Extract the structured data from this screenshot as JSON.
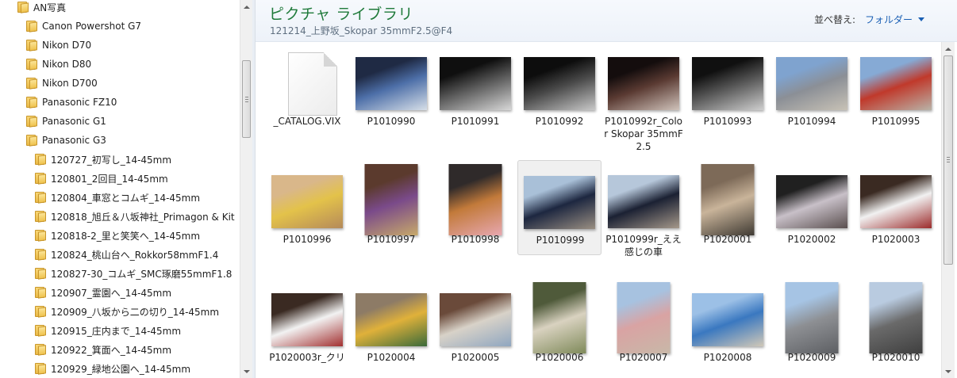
{
  "nav": {
    "items": [
      {
        "label": "AN写真",
        "level": 0
      },
      {
        "label": "Canon Powershot G7",
        "level": 1
      },
      {
        "label": "Nikon D70",
        "level": 1
      },
      {
        "label": "Nikon D80",
        "level": 1
      },
      {
        "label": "Nikon D700",
        "level": 1
      },
      {
        "label": "Panasonic FZ10",
        "level": 1
      },
      {
        "label": "Panasonic G1",
        "level": 1
      },
      {
        "label": "Panasonic G3",
        "level": 1
      },
      {
        "label": "120727_初写し_14-45mm",
        "level": 2
      },
      {
        "label": "120801_2回目_14-45mm",
        "level": 2
      },
      {
        "label": "120804_車窓とコムギ_14-45mm",
        "level": 2
      },
      {
        "label": "120818_旭丘＆八坂神社_Primagon & Kit",
        "level": 2
      },
      {
        "label": "120818-2_里と笑笑へ_14-45mm",
        "level": 2
      },
      {
        "label": "120824_桃山台へ_Rokkor58mmF1.4",
        "level": 2
      },
      {
        "label": "120827-30_コムギ_SMC琢磨55mmF1.8",
        "level": 2
      },
      {
        "label": "120907_霊園へ_14-45mm",
        "level": 2
      },
      {
        "label": "120909_八坂から二の切り_14-45mm",
        "level": 2
      },
      {
        "label": "120915_庄内まで_14-45mm",
        "level": 2
      },
      {
        "label": "120922_箕面へ_14-45mm",
        "level": 2
      },
      {
        "label": "120929_緑地公園へ_14-45mm",
        "level": 2
      }
    ]
  },
  "library": {
    "title": "ピクチャ ライブラリ",
    "subtitle": "121214_上野坂_Skopar 35mmF2.5@F4",
    "sort_label": "並べ替え:",
    "sort_value": "フォルダー"
  },
  "files": [
    {
      "name": "_CATALOG.VIX",
      "kind": "document"
    },
    {
      "name": "P1010990",
      "colors": [
        "#1f2a44",
        "#4d6fa8",
        "#d7dfe8"
      ],
      "aspect": "landscape"
    },
    {
      "name": "P1010991",
      "colors": [
        "#0f0f0f",
        "#5b5b5b",
        "#d8d8d8"
      ],
      "aspect": "landscape"
    },
    {
      "name": "P1010992",
      "colors": [
        "#0d0d0d",
        "#4a4a4a",
        "#c9c9c9"
      ],
      "aspect": "landscape"
    },
    {
      "name": "P1010992r_Color Skopar 35mmF2.5",
      "colors": [
        "#140d0d",
        "#5a3a32",
        "#d0c3bb"
      ],
      "aspect": "landscape"
    },
    {
      "name": "P1010993",
      "colors": [
        "#101010",
        "#555555",
        "#cfcfcf"
      ],
      "aspect": "landscape"
    },
    {
      "name": "P1010994",
      "colors": [
        "#7fa3cf",
        "#8b8f96",
        "#c8c2b6"
      ],
      "aspect": "landscape"
    },
    {
      "name": "P1010995",
      "colors": [
        "#86aad5",
        "#c0392b",
        "#b9b3a8"
      ],
      "aspect": "landscape"
    },
    {
      "name": "P1010996",
      "colors": [
        "#d9b78a",
        "#e3c24a",
        "#b58a5a"
      ],
      "aspect": "landscape"
    },
    {
      "name": "P1010997",
      "colors": [
        "#5b3a2d",
        "#7a4a8a",
        "#c7a96a"
      ],
      "aspect": "portrait"
    },
    {
      "name": "P1010998",
      "colors": [
        "#2f2a2a",
        "#c27a3a",
        "#e7a7b0"
      ],
      "aspect": "portrait"
    },
    {
      "name": "P1010999",
      "colors": [
        "#a9c0d8",
        "#1d2740",
        "#9a8f82"
      ],
      "aspect": "landscape"
    },
    {
      "name": "P1010999r_ええ感じの車",
      "colors": [
        "#b6c7da",
        "#1b2133",
        "#a5988a"
      ],
      "aspect": "landscape"
    },
    {
      "name": "P1020001",
      "colors": [
        "#7d6a58",
        "#c9b49a",
        "#3f3a33"
      ],
      "aspect": "portrait"
    },
    {
      "name": "P1020002",
      "colors": [
        "#202020",
        "#c8c0c8",
        "#5a4f4f"
      ],
      "aspect": "landscape"
    },
    {
      "name": "P1020003",
      "colors": [
        "#3a2a22",
        "#f1f1f1",
        "#9c2b2b"
      ],
      "aspect": "landscape"
    },
    {
      "name": "P1020003r_クリ",
      "colors": [
        "#3a2a22",
        "#f2f2f2",
        "#a23030"
      ],
      "aspect": "landscape"
    },
    {
      "name": "P1020004",
      "colors": [
        "#8d7b66",
        "#e0b13a",
        "#3a6a3a"
      ],
      "aspect": "landscape"
    },
    {
      "name": "P1020005",
      "colors": [
        "#6a4a3a",
        "#d8d2c8",
        "#8fa6c0"
      ],
      "aspect": "landscape"
    },
    {
      "name": "P1020006",
      "colors": [
        "#4f5a3a",
        "#d9d2c0",
        "#7f8a5a"
      ],
      "aspect": "portrait"
    },
    {
      "name": "P1020007",
      "colors": [
        "#a7c2e0",
        "#d9a3a3",
        "#c8b8a8"
      ],
      "aspect": "portrait"
    },
    {
      "name": "P1020008",
      "colors": [
        "#9cc0e6",
        "#3a78c0",
        "#d0c8b8"
      ],
      "aspect": "landscape"
    },
    {
      "name": "P1020009",
      "colors": [
        "#a6c4e4",
        "#8d8f93",
        "#5d5f63"
      ],
      "aspect": "portrait"
    },
    {
      "name": "P1020010",
      "colors": [
        "#b9cbe0",
        "#6a6a6a",
        "#3f3f3f"
      ],
      "aspect": "portrait"
    }
  ],
  "selected_file": "P1010999"
}
